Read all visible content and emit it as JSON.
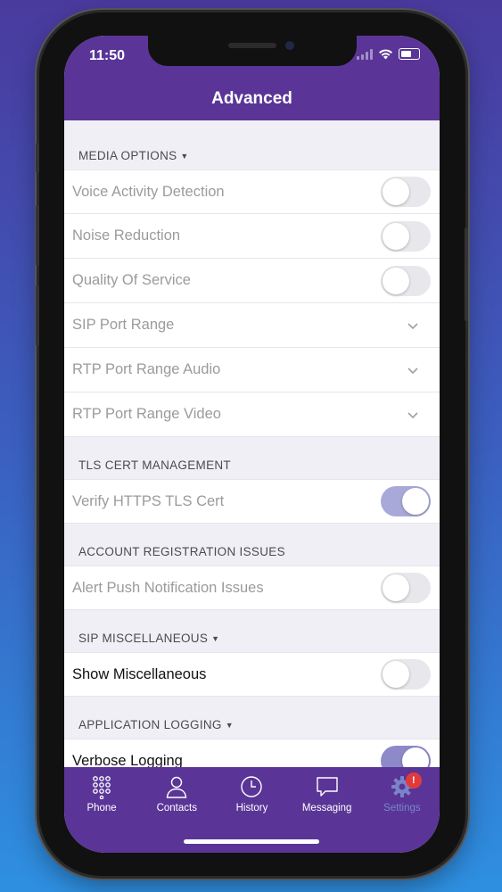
{
  "status": {
    "time": "11:50"
  },
  "header": {
    "title": "Advanced"
  },
  "sections": {
    "media": {
      "title": "MEDIA OPTIONS",
      "items": [
        {
          "label": "Voice Activity Detection",
          "control": "toggle",
          "on": false
        },
        {
          "label": "Noise Reduction",
          "control": "toggle",
          "on": false
        },
        {
          "label": "Quality Of Service",
          "control": "toggle",
          "on": false
        },
        {
          "label": "SIP Port Range",
          "control": "chevron"
        },
        {
          "label": "RTP Port Range Audio",
          "control": "chevron"
        },
        {
          "label": "RTP Port Range Video",
          "control": "chevron"
        }
      ]
    },
    "tls": {
      "title": "TLS CERT MANAGEMENT",
      "items": [
        {
          "label": "Verify HTTPS TLS Cert",
          "control": "toggle",
          "on": true
        }
      ]
    },
    "account": {
      "title": "ACCOUNT REGISTRATION ISSUES",
      "items": [
        {
          "label": "Alert Push Notification Issues",
          "control": "toggle",
          "on": false
        }
      ]
    },
    "sip_misc": {
      "title": "SIP MISCELLANEOUS",
      "items": [
        {
          "label": "Show Miscellaneous",
          "control": "toggle",
          "on": false
        }
      ]
    },
    "logging": {
      "title": "APPLICATION LOGGING",
      "items": [
        {
          "label": "Verbose Logging",
          "control": "toggle",
          "on": true
        }
      ]
    }
  },
  "tabbar": {
    "items": [
      {
        "label": "Phone",
        "icon": "dialpad-icon"
      },
      {
        "label": "Contacts",
        "icon": "person-icon"
      },
      {
        "label": "History",
        "icon": "clock-icon"
      },
      {
        "label": "Messaging",
        "icon": "chat-bubble-icon"
      },
      {
        "label": "Settings",
        "icon": "gear-icon",
        "selected": true,
        "badge": "!"
      }
    ]
  },
  "colors": {
    "header": "#5a3597",
    "background": "#f0eff5",
    "badge": "#e23a3a"
  }
}
